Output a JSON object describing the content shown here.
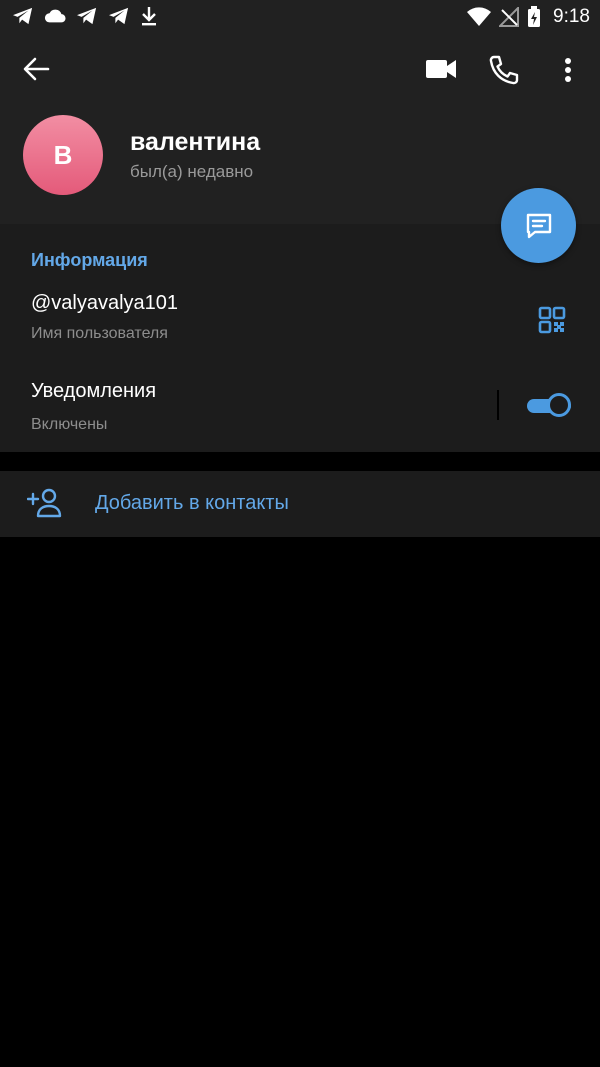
{
  "status_bar": {
    "time": "9:18",
    "left_icons": [
      "telegram-icon",
      "cloud-icon",
      "telegram-icon",
      "telegram-icon",
      "download-icon"
    ],
    "right_icons": [
      "wifi-icon",
      "no-signal-icon",
      "battery-charging-icon"
    ]
  },
  "header": {
    "avatar_letter": "В",
    "name": "валентина",
    "status": "был(а) недавно",
    "actions": [
      "back-arrow-icon",
      "video-camera-icon",
      "phone-icon",
      "more-vert-icon"
    ]
  },
  "info": {
    "title": "Информация",
    "username": "@valyavalya101",
    "username_label": "Имя пользователя",
    "notifications": "Уведомления",
    "notifications_state": "Включены",
    "notifications_on": true
  },
  "add_contact": {
    "label": "Добавить в контакты"
  },
  "colors": {
    "accent": "#4b9ae0",
    "accent_text": "#63a8e8",
    "header_bg": "#212121",
    "section_bg": "#1c1c1c",
    "page_bg": "#000000"
  }
}
